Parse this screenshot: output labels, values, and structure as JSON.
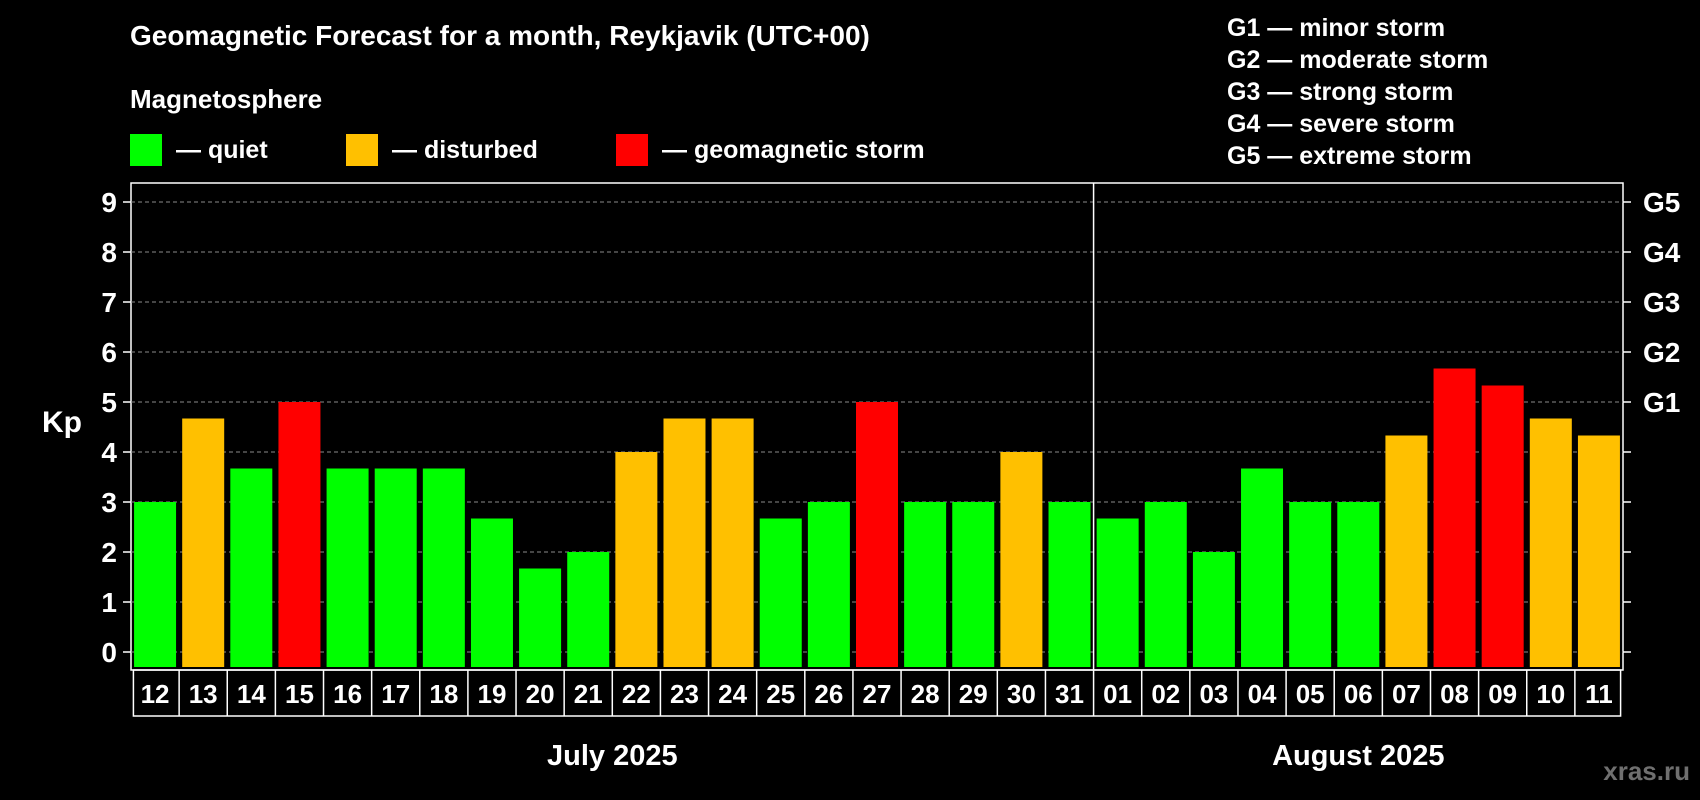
{
  "chart_data": {
    "type": "bar",
    "title": "Geomagnetic Forecast for a month, Reykjavik (UTC+00)",
    "subtitle": "Magnetosphere",
    "ylabel": "Kp",
    "ylim": [
      0,
      9
    ],
    "yticks": [
      "0",
      "1",
      "2",
      "3",
      "4",
      "5",
      "6",
      "7",
      "8",
      "9"
    ],
    "grid": true,
    "legend": [
      {
        "label": "— quiet",
        "color": "#00ff00"
      },
      {
        "label": "— disturbed",
        "color": "#ffc000"
      },
      {
        "label": "— geomagnetic storm",
        "color": "#ff0000"
      }
    ],
    "storm_levels": [
      {
        "label": "G1",
        "kp": 5
      },
      {
        "label": "G2",
        "kp": 6
      },
      {
        "label": "G3",
        "kp": 7
      },
      {
        "label": "G4",
        "kp": 8
      },
      {
        "label": "G5",
        "kp": 9
      }
    ],
    "storm_legend": [
      "G1 — minor storm",
      "G2 — moderate storm",
      "G3 — strong storm",
      "G4 — severe storm",
      "G5 — extreme storm"
    ],
    "months": [
      {
        "name": "July 2025",
        "days": 20
      },
      {
        "name": "August 2025",
        "days": 11
      }
    ],
    "categories": [
      "12",
      "13",
      "14",
      "15",
      "16",
      "17",
      "18",
      "19",
      "20",
      "21",
      "22",
      "23",
      "24",
      "25",
      "26",
      "27",
      "28",
      "29",
      "30",
      "31",
      "01",
      "02",
      "03",
      "04",
      "05",
      "06",
      "07",
      "08",
      "09",
      "10",
      "11"
    ],
    "values": [
      3,
      4.67,
      3.67,
      5,
      3.67,
      3.67,
      3.67,
      2.67,
      1.67,
      2,
      4,
      4.67,
      4.67,
      2.67,
      3,
      5,
      3,
      3,
      4,
      3,
      2.67,
      3,
      2,
      3.67,
      3,
      3,
      4.33,
      5.67,
      5.33,
      4.67,
      4.33
    ],
    "status": [
      "quiet",
      "disturbed",
      "quiet",
      "storm",
      "quiet",
      "quiet",
      "quiet",
      "quiet",
      "quiet",
      "quiet",
      "disturbed",
      "disturbed",
      "disturbed",
      "quiet",
      "quiet",
      "storm",
      "quiet",
      "quiet",
      "disturbed",
      "quiet",
      "quiet",
      "quiet",
      "quiet",
      "quiet",
      "quiet",
      "quiet",
      "disturbed",
      "storm",
      "storm",
      "disturbed",
      "disturbed"
    ],
    "colors": {
      "quiet": "#00ff00",
      "disturbed": "#ffc000",
      "storm": "#ff0000",
      "grid": "#8a8a8a"
    }
  },
  "watermark": "xras.ru"
}
